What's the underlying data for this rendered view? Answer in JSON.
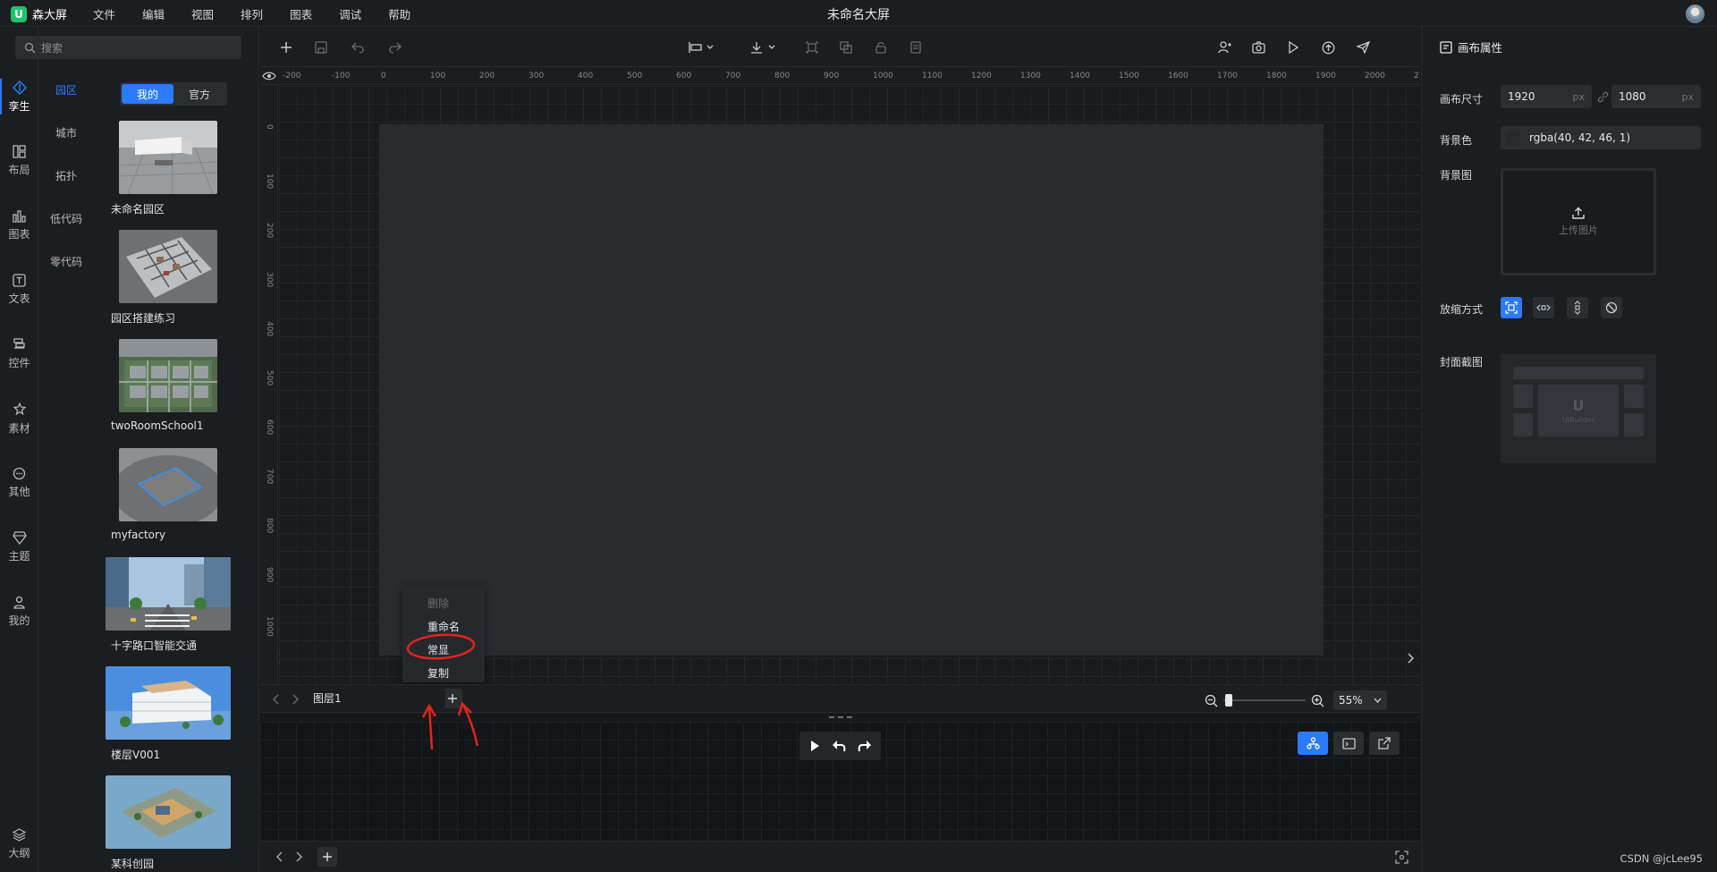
{
  "app": {
    "logo_mark": "U",
    "logo_text": "森大屏",
    "title": "未命名大屏"
  },
  "menu": [
    "文件",
    "编辑",
    "视图",
    "排列",
    "图表",
    "调试",
    "帮助"
  ],
  "search": {
    "placeholder": "搜索"
  },
  "left_rail": [
    {
      "label": "孪生",
      "icon": "twin-icon"
    },
    {
      "label": "布局",
      "icon": "layout-icon"
    },
    {
      "label": "图表",
      "icon": "chart-icon"
    },
    {
      "label": "文表",
      "icon": "text-icon"
    },
    {
      "label": "控件",
      "icon": "widget-icon"
    },
    {
      "label": "素材",
      "icon": "material-icon"
    },
    {
      "label": "其他",
      "icon": "more-icon"
    },
    {
      "label": "主题",
      "icon": "theme-icon"
    },
    {
      "label": "我的",
      "icon": "user-icon"
    },
    {
      "label": "大纲",
      "icon": "layers-icon"
    }
  ],
  "subnav": [
    "园区",
    "城市",
    "拓扑",
    "低代码",
    "零代码"
  ],
  "segment": {
    "mine": "我的",
    "official": "官方"
  },
  "assets": [
    {
      "name": "未命名园区"
    },
    {
      "name": "园区搭建练习"
    },
    {
      "name": "twoRoomSchool1"
    },
    {
      "name": "myfactory"
    },
    {
      "name": "十字路口智能交通"
    },
    {
      "name": "楼层V001"
    },
    {
      "name": "某科创园"
    }
  ],
  "ruler": {
    "h": [
      "-200",
      "-100",
      "0",
      "100",
      "200",
      "300",
      "400",
      "500",
      "600",
      "700",
      "800",
      "900",
      "1000",
      "1100",
      "1200",
      "1300",
      "1400",
      "1500",
      "1600",
      "1700",
      "1800",
      "1900",
      "2000",
      "21"
    ],
    "v": [
      "0",
      "100",
      "200",
      "300",
      "400",
      "500",
      "600",
      "700",
      "800",
      "900",
      "1000"
    ]
  },
  "context_menu": [
    "删除",
    "重命名",
    "常显",
    "复制"
  ],
  "layer": {
    "name": "图层1"
  },
  "zoom": {
    "label": "55%",
    "level": 0.55
  },
  "props": {
    "title": "画布属性",
    "size_label": "画布尺寸",
    "width": "1920",
    "height": "1080",
    "unit": "px",
    "bg_color_label": "背景色",
    "bg_color": "rgba(40, 42, 46, 1)",
    "bg_image_label": "背景图",
    "upload_text": "上传图片",
    "scale_label": "放缩方式",
    "cover_label": "封面截图",
    "cover_brand": "UIBuilder"
  },
  "watermark": "CSDN @jcLee95",
  "colors": {
    "accent": "#2b7bff",
    "brand": "#1fc36a",
    "annotation": "#e0241b"
  }
}
